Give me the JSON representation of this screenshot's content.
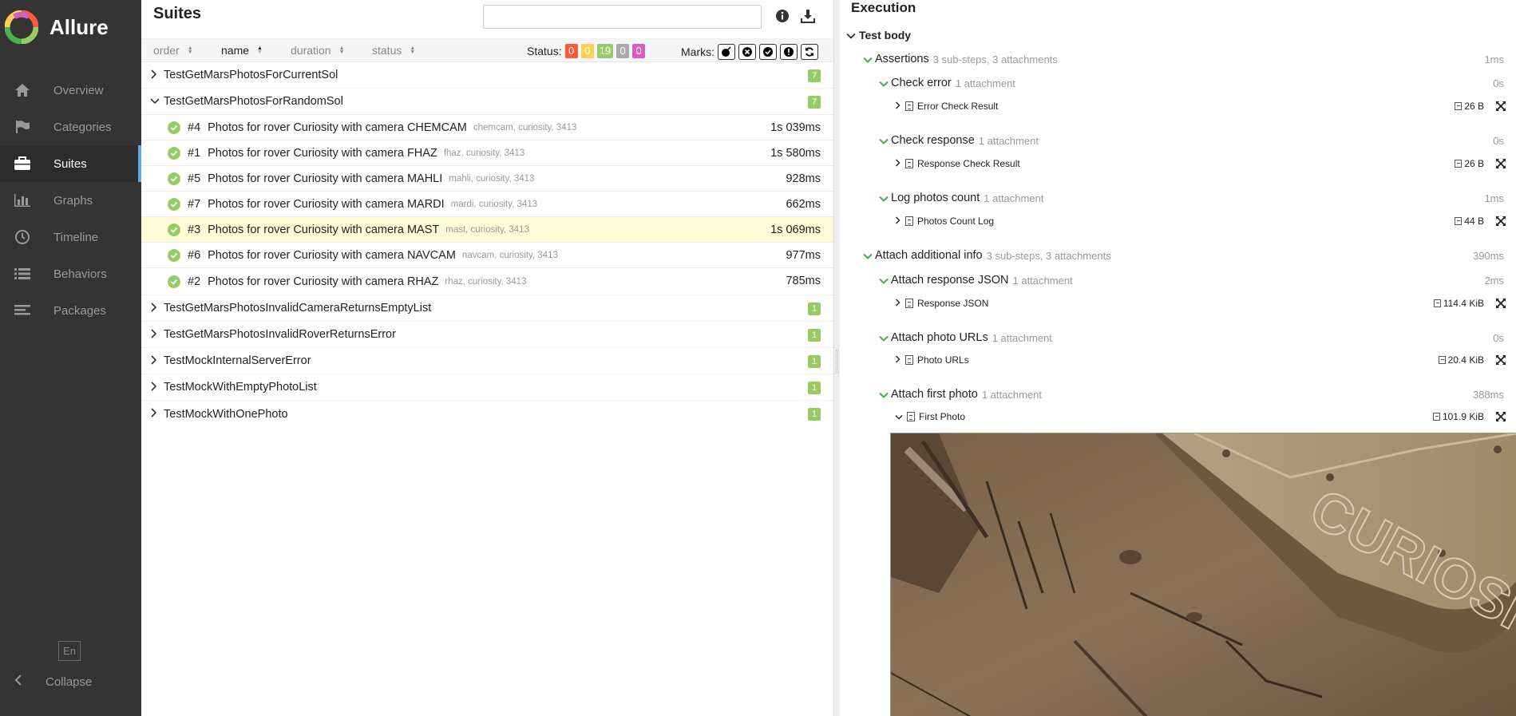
{
  "app": {
    "name": "Allure"
  },
  "sidebar": {
    "items": [
      {
        "label": "Overview",
        "icon": "home-icon"
      },
      {
        "label": "Categories",
        "icon": "flag-icon"
      },
      {
        "label": "Suites",
        "icon": "briefcase-icon",
        "active": true
      },
      {
        "label": "Graphs",
        "icon": "bar-chart-icon"
      },
      {
        "label": "Timeline",
        "icon": "clock-icon"
      },
      {
        "label": "Behaviors",
        "icon": "list-icon"
      },
      {
        "label": "Packages",
        "icon": "align-left-icon"
      }
    ],
    "lang": "En",
    "collapse": "Collapse"
  },
  "suites": {
    "title": "Suites",
    "search_value": "",
    "sort": {
      "order": "order",
      "name": "name",
      "duration": "duration",
      "status": "status"
    },
    "status_label": "Status:",
    "status_counts": [
      {
        "value": "0",
        "color": "#fd5a3e"
      },
      {
        "value": "0",
        "color": "#ffd050"
      },
      {
        "value": "19",
        "color": "#97cc64"
      },
      {
        "value": "0",
        "color": "#aaaaaa"
      },
      {
        "value": "0",
        "color": "#d35ebe"
      }
    ],
    "marks_label": "Marks:",
    "groups": [
      {
        "name": "TestGetMarsPhotosForCurrentSol",
        "count": "7",
        "expanded": false
      },
      {
        "name": "TestGetMarsPhotosForRandomSol",
        "count": "7",
        "expanded": true,
        "cases": [
          {
            "num": "#4",
            "name": "Photos for rover Curiosity with camera CHEMCAM",
            "tags": "chemcam, curiosity, 3413",
            "duration": "1s 039ms"
          },
          {
            "num": "#1",
            "name": "Photos for rover Curiosity with camera FHAZ",
            "tags": "fhaz, curiosity, 3413",
            "duration": "1s 580ms"
          },
          {
            "num": "#5",
            "name": "Photos for rover Curiosity with camera MAHLI",
            "tags": "mahli, curiosity, 3413",
            "duration": "928ms"
          },
          {
            "num": "#7",
            "name": "Photos for rover Curiosity with camera MARDI",
            "tags": "mardi, curiosity, 3413",
            "duration": "662ms"
          },
          {
            "num": "#3",
            "name": "Photos for rover Curiosity with camera MAST",
            "tags": "mast, curiosity, 3413",
            "duration": "1s 069ms",
            "selected": true
          },
          {
            "num": "#6",
            "name": "Photos for rover Curiosity with camera NAVCAM",
            "tags": "navcam, curiosity, 3413",
            "duration": "977ms"
          },
          {
            "num": "#2",
            "name": "Photos for rover Curiosity with camera RHAZ",
            "tags": "rhaz, curiosity, 3413",
            "duration": "785ms"
          }
        ]
      },
      {
        "name": "TestGetMarsPhotosInvalidCameraReturnsEmptyList",
        "count": "1"
      },
      {
        "name": "TestGetMarsPhotosInvalidRoverReturnsError",
        "count": "1"
      },
      {
        "name": "TestMockInternalServerError",
        "count": "1"
      },
      {
        "name": "TestMockWithEmptyPhotoList",
        "count": "1"
      },
      {
        "name": "TestMockWithOnePhoto",
        "count": "1"
      }
    ]
  },
  "execution": {
    "title": "Execution",
    "test_body": "Test body",
    "steps": [
      {
        "name": "Assertions",
        "sub": "3 sub-steps, 3 attachments",
        "time": "1ms"
      },
      {
        "name": "Check error",
        "sub": "1 attachment",
        "time": "0s"
      },
      {
        "name": "Error Check Result",
        "size": "26 B"
      },
      {
        "name": "Check response",
        "sub": "1 attachment",
        "time": "0s"
      },
      {
        "name": "Response Check Result",
        "size": "26 B"
      },
      {
        "name": "Log photos count",
        "sub": "1 attachment",
        "time": "1ms"
      },
      {
        "name": "Photos Count Log",
        "size": "44 B"
      },
      {
        "name": "Attach additional info",
        "sub": "3 sub-steps, 3 attachments",
        "time": "390ms"
      },
      {
        "name": "Attach response JSON",
        "sub": "1 attachment",
        "time": "2ms"
      },
      {
        "name": "Response JSON",
        "size": "114.4 KiB"
      },
      {
        "name": "Attach photo URLs",
        "sub": "1 attachment",
        "time": "0s"
      },
      {
        "name": "Photo URLs",
        "size": "20.4 KiB"
      },
      {
        "name": "Attach first photo",
        "sub": "1 attachment",
        "time": "388ms"
      },
      {
        "name": "First Photo",
        "size": "101.9 KiB"
      }
    ],
    "photo_text": "CURIOSITY"
  }
}
